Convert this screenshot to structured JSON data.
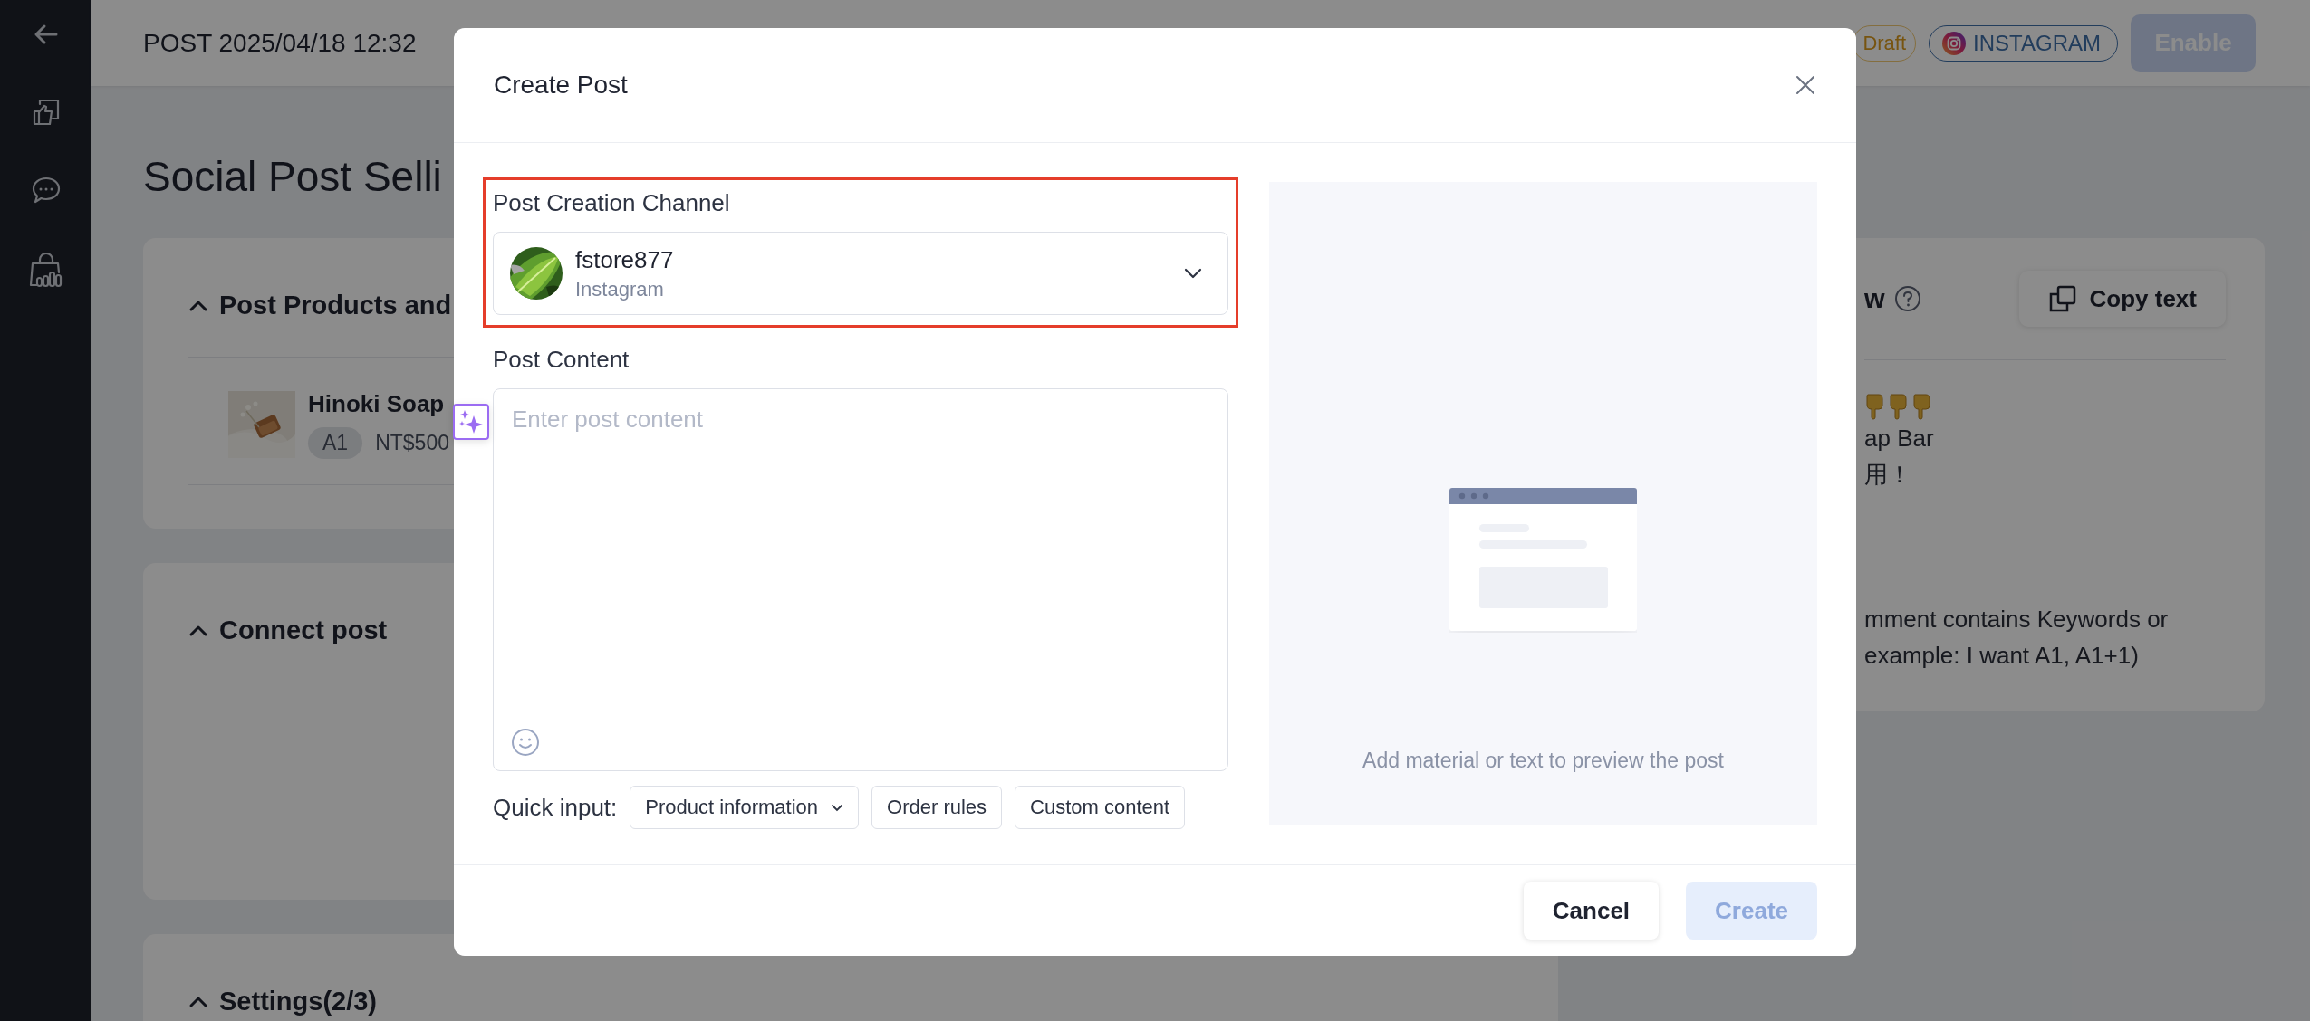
{
  "header": {
    "title": "POST 2025/04/18 12:32",
    "status": "Draft",
    "channel": "INSTAGRAM",
    "enable_button": {
      "label": "Enable",
      "disabled": true
    }
  },
  "page_title": "Social Post Selli",
  "sections": [
    {
      "title": "Post Products and",
      "expanded": true,
      "products": [
        {
          "name": "Hinoki Soap",
          "keyword": "A1",
          "price": "NT$500"
        }
      ]
    },
    {
      "title": "Connect post",
      "expanded": true
    },
    {
      "title": "Settings(2/3)",
      "expanded": true
    }
  ],
  "preview_panel": {
    "title": "w",
    "copy_button": "Copy text",
    "paragraphs": [
      [
        "ap Bar",
        "用！"
      ],
      [
        "mment contains Keywords or",
        "example: I want A1, A1+1)"
      ]
    ]
  },
  "dialog": {
    "title": "Create Post",
    "channel": {
      "label": "Post Creation Channel",
      "highlighted": true,
      "account": "fstore877",
      "platform": "Instagram"
    },
    "content": {
      "label": "Post Content",
      "placeholder": "Enter post content"
    },
    "quick_input": {
      "label": "Quick input:",
      "options": [
        {
          "label": "Product information",
          "kind": "dropdown"
        },
        {
          "label": "Order rules",
          "kind": "button"
        },
        {
          "label": "Custom content",
          "kind": "button"
        }
      ]
    },
    "preview": {
      "hint": "Add material or text to preview the post"
    },
    "buttons": [
      {
        "label": "Cancel",
        "kind": "secondary",
        "disabled": false
      },
      {
        "label": "Create",
        "kind": "primary",
        "disabled": true
      }
    ]
  }
}
